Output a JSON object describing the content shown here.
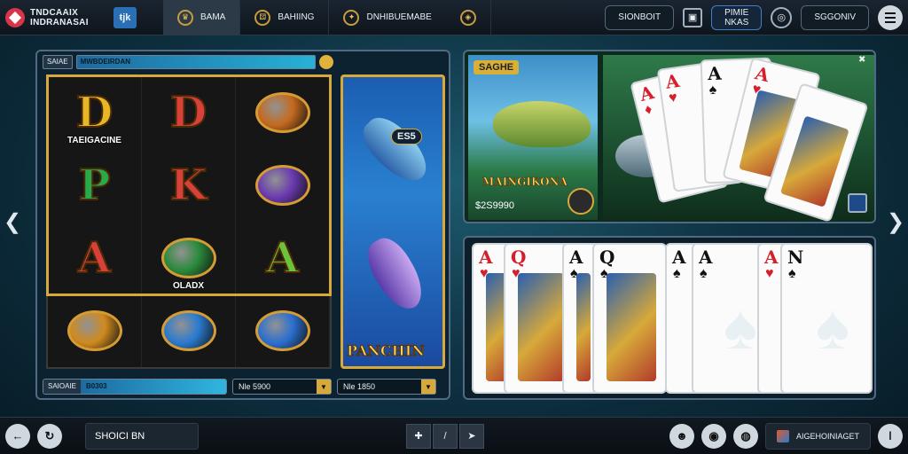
{
  "header": {
    "logo_line1": "TNDCAAIX",
    "logo_line2": "INDRANASAI",
    "badge": "ŧjk",
    "tabs": [
      {
        "label": "BAMA",
        "icon": "crown-icon",
        "active": true
      },
      {
        "label": "BAHIING",
        "icon": "dice-icon",
        "active": false
      },
      {
        "label": "DNHIBUEMABE",
        "icon": "compass-icon",
        "active": false
      }
    ],
    "pill_label": "SIONBOIT",
    "blue_pill_line1": "PIMIE",
    "blue_pill_line2": "NKAS",
    "right_pill_label": "SGGONIV"
  },
  "slot": {
    "head_label": "SAIAE",
    "head_meter": "MWBDEIRDAN",
    "symbols": [
      {
        "letter": "D",
        "color": "#e7b727",
        "caption": "TAEIGACINE"
      },
      {
        "letter": "D",
        "color": "#d8403a",
        "caption": ""
      },
      {
        "letter": "",
        "color": "#c46a1e",
        "caption": ""
      },
      {
        "letter": "P",
        "color": "#2aa94a",
        "caption": ""
      },
      {
        "letter": "K",
        "color": "#d8403a",
        "caption": ""
      },
      {
        "letter": "",
        "color": "#6a3ab0",
        "caption": ""
      },
      {
        "letter": "A",
        "color": "#d8403a",
        "caption": ""
      },
      {
        "letter": "",
        "color": "#2a8a3a",
        "caption": "OLADX"
      },
      {
        "letter": "A",
        "color": "#6cc23a",
        "caption": ""
      },
      {
        "letter": "",
        "color": "#d08a1e",
        "caption": ""
      },
      {
        "letter": "",
        "color": "#2a7ad0",
        "caption": ""
      },
      {
        "letter": "",
        "color": "#2a6fd0",
        "caption": ""
      }
    ],
    "fish_tag": "ES5",
    "fish_title": "PANCHIN",
    "balance_label": "SAIOAIE",
    "balance_value": "B0303",
    "bet1": "Nle 5900",
    "bet2": "Nle 1850"
  },
  "fish_panel": {
    "tag": "SAGHE",
    "title": "MAINGIKONA",
    "amount": "$2S9990",
    "cards": [
      {
        "rank": "A",
        "suit": "♦",
        "color": "red"
      },
      {
        "rank": "A",
        "suit": "♥",
        "color": "red"
      },
      {
        "rank": "A",
        "suit": "♠",
        "color": "blk"
      },
      {
        "rank": "A",
        "suit": "♥",
        "color": "red"
      },
      {
        "rank": "",
        "suit": "",
        "color": "red"
      }
    ]
  },
  "cards_row": [
    {
      "rank": "A",
      "suit": "♥",
      "color": "red",
      "pip": "",
      "art": true
    },
    {
      "rank": "Q",
      "suit": "♥",
      "color": "red",
      "pip": "",
      "art": true
    },
    {
      "rank": "A",
      "suit": "♠",
      "color": "blk",
      "pip": "",
      "art": true
    },
    {
      "rank": "Q",
      "suit": "♠",
      "color": "blk",
      "pip": "",
      "art": true
    },
    {
      "rank": "A",
      "suit": "♠",
      "color": "blk",
      "pip": "",
      "art": false
    },
    {
      "rank": "A",
      "suit": "♠",
      "color": "blk",
      "pip": "♠",
      "art": false
    },
    {
      "rank": "A",
      "suit": "♥",
      "color": "red",
      "pip": "",
      "art": false
    },
    {
      "rank": "N",
      "suit": "♠",
      "color": "blk",
      "pip": "♠",
      "art": false
    }
  ],
  "footer": {
    "search_value": "SHOICI BN",
    "right_button": "AIGEHOINIAGET"
  }
}
